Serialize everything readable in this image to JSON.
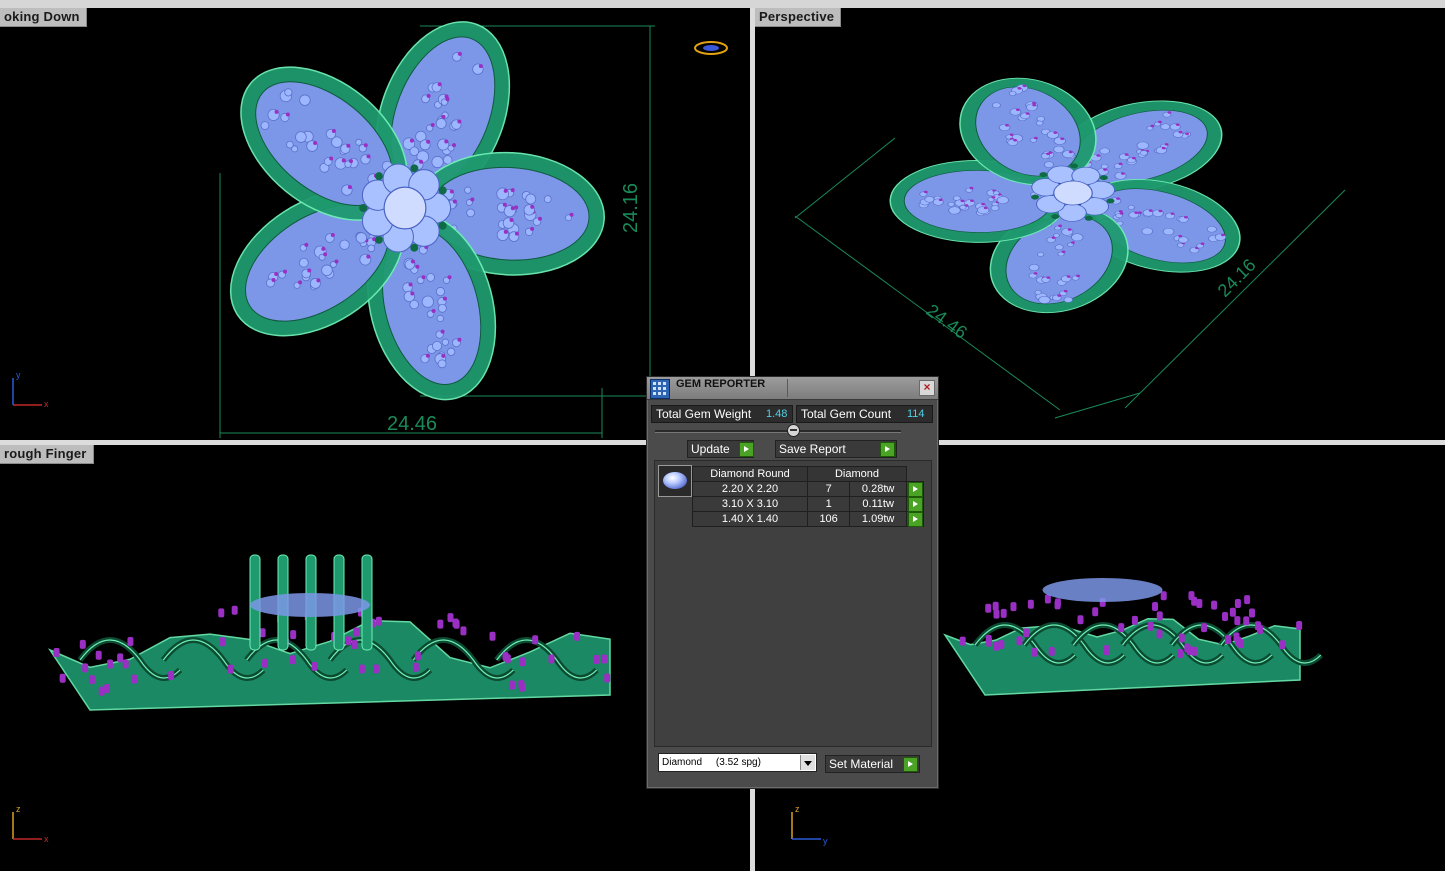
{
  "viewports": [
    {
      "label": "oking Down"
    },
    {
      "label": "Perspective"
    },
    {
      "label": "rough Finger"
    },
    {
      "label": ""
    }
  ],
  "dimensions": {
    "top_width": "24.46",
    "top_height": "24.16",
    "persp_width": "24.46",
    "persp_height": "24.16"
  },
  "axes": {
    "top_left": {
      "a": "y",
      "b": "x"
    },
    "bottom_left": {
      "a": "z",
      "b": "x"
    },
    "bottom_right": {
      "a": "z",
      "b": "y"
    }
  },
  "colors": {
    "metal": "#1f9a6f",
    "metal_edge": "#6ff0b5",
    "gem": "#9db7ff",
    "prong": "#9a2fc4",
    "dimension": "#1a8a58",
    "value_text": "#4fd1e6"
  },
  "gem_reporter": {
    "title": "GEM REPORTER",
    "close_icon": "close-icon",
    "total_weight_label": "Total Gem Weight",
    "total_weight_value": "1.48",
    "total_count_label": "Total Gem Count",
    "total_count_value": "114",
    "update_label": "Update",
    "save_report_label": "Save Report",
    "table": {
      "headers": [
        "Diamond Round",
        "Diamond"
      ],
      "rows": [
        {
          "size": "2.20 X 2.20",
          "count": "7",
          "weight": "0.28tw"
        },
        {
          "size": "3.10 X 3.10",
          "count": "1",
          "weight": "0.11tw"
        },
        {
          "size": "1.40 X 1.40",
          "count": "106",
          "weight": "1.09tw"
        }
      ]
    },
    "material_select": "Diamond     (3.52 spg)",
    "set_material_label": "Set Material"
  }
}
